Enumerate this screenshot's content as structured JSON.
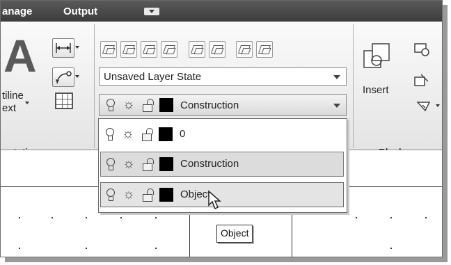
{
  "menu": {
    "manage": "anage",
    "output": "Output",
    "dropdown_icon": "menu-dropdown-icon"
  },
  "annotation_panel": {
    "big_letter": "A",
    "mtext_line1": "tiline",
    "mtext_line2": "ext",
    "title": "notation"
  },
  "layers_panel": {
    "layer_state_value": "Unsaved Layer State",
    "current_layer": "Construction",
    "tool_icons": [
      "layer-properties-icon",
      "layer-states-icon",
      "isolate-icon",
      "unisolate-icon",
      "freeze-icon",
      "off-icon",
      "match-icon",
      "previous-icon"
    ]
  },
  "block_panel": {
    "insert_label": "Insert",
    "title": "Block"
  },
  "layer_list": [
    {
      "name": "0",
      "highlighted": false
    },
    {
      "name": "Construction",
      "highlighted": true
    },
    {
      "name": "Object",
      "highlighted": true
    }
  ],
  "tooltip": "Object",
  "colors": {
    "menu_bar": "#3c3c3c",
    "ribbon_bg": "#e8e8e8",
    "highlight_row": "#dcdcdc",
    "swatch": "#000000"
  }
}
